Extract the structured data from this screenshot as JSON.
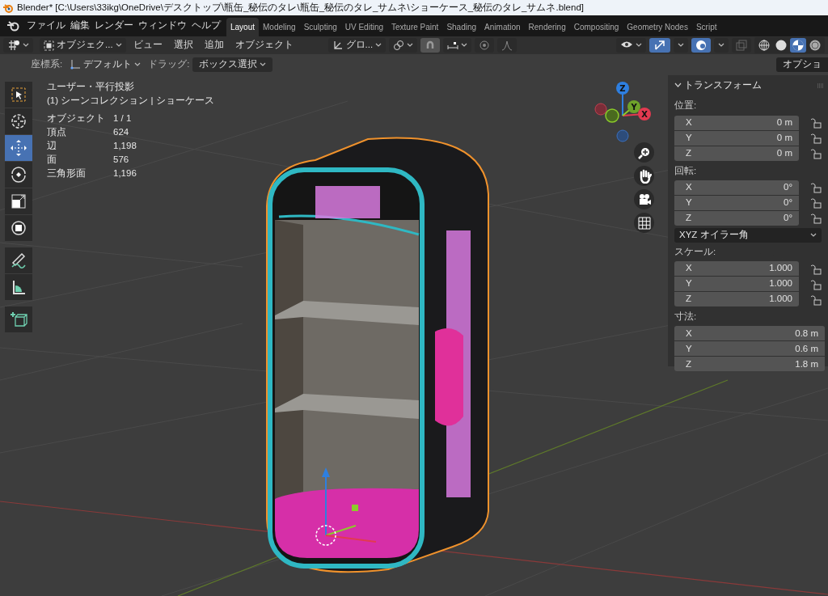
{
  "window": {
    "title": "Blender* [C:\\Users\\33ikg\\OneDrive\\デスクトップ\\瓶缶_秘伝のタレ\\瓶缶_秘伝のタレ_サムネ\\ショーケース_秘伝のタレ_サムネ.blend]"
  },
  "menu": [
    "ファイル",
    "編集",
    "レンダー",
    "ウィンドウ",
    "ヘルプ"
  ],
  "workspaces": [
    {
      "label": "Layout",
      "selected": true
    },
    {
      "label": "Modeling",
      "selected": false
    },
    {
      "label": "Sculpting",
      "selected": false
    },
    {
      "label": "UV Editing",
      "selected": false
    },
    {
      "label": "Texture Paint",
      "selected": false
    },
    {
      "label": "Shading",
      "selected": false
    },
    {
      "label": "Animation",
      "selected": false
    },
    {
      "label": "Rendering",
      "selected": false
    },
    {
      "label": "Compositing",
      "selected": false
    },
    {
      "label": "Geometry Nodes",
      "selected": false
    },
    {
      "label": "Script",
      "selected": false
    }
  ],
  "header": {
    "mode": "オブジェク...",
    "menus": [
      "ビュー",
      "選択",
      "追加",
      "オブジェクト"
    ],
    "orientation": "グロ...",
    "gizmos_on": true,
    "overlays_on": true,
    "shading_modes": [
      {
        "kind": "wireframe",
        "selected": false
      },
      {
        "kind": "solid",
        "selected": false
      },
      {
        "kind": "material",
        "selected": true
      },
      {
        "kind": "rendered",
        "selected": false
      }
    ]
  },
  "tool_settings": {
    "orientation_label": "座標系:",
    "orientation": "デフォルト",
    "drag_label": "ドラッグ:",
    "drag": "ボックス選択",
    "options": "オプショ"
  },
  "toolbar": [
    {
      "kind": "select",
      "selected": false
    },
    {
      "kind": "cursor",
      "selected": false
    },
    {
      "kind": "move",
      "selected": true
    },
    {
      "kind": "rotate",
      "selected": false
    },
    {
      "kind": "scale",
      "selected": false
    },
    {
      "kind": "transform",
      "selected": false
    },
    {
      "kind": "annotate",
      "selected": false
    },
    {
      "kind": "measure",
      "selected": false
    },
    {
      "kind": "add-cube",
      "selected": false
    }
  ],
  "viewport_info": {
    "view": "ユーザー・平行投影",
    "collection": "(1) シーンコレクション | ショーケース",
    "stats": [
      {
        "label": "オブジェクト",
        "value": "1 / 1"
      },
      {
        "label": "頂点",
        "value": "624"
      },
      {
        "label": "辺",
        "value": "1,198"
      },
      {
        "label": "面",
        "value": "576"
      },
      {
        "label": "三角形面",
        "value": "1,196"
      }
    ]
  },
  "gizmo": {
    "labels": [
      "Z",
      "Y",
      "X"
    ]
  },
  "transform_panel": {
    "title": "トランスフォーム",
    "expanded": true,
    "sections": [
      {
        "label": "位置:",
        "fields": [
          {
            "axis": "X",
            "value": "0 m",
            "locked": false
          },
          {
            "axis": "Y",
            "value": "0 m",
            "locked": false
          },
          {
            "axis": "Z",
            "value": "0 m",
            "locked": false
          }
        ]
      },
      {
        "label": "回転:",
        "fields": [
          {
            "axis": "X",
            "value": "0°",
            "locked": false
          },
          {
            "axis": "Y",
            "value": "0°",
            "locked": false
          },
          {
            "axis": "Z",
            "value": "0°",
            "locked": false
          }
        ],
        "mode": "XYZ オイラー角"
      },
      {
        "label": "スケール:",
        "fields": [
          {
            "axis": "X",
            "value": "1.000",
            "locked": false
          },
          {
            "axis": "Y",
            "value": "1.000",
            "locked": false
          },
          {
            "axis": "Z",
            "value": "1.000",
            "locked": false
          }
        ]
      },
      {
        "label": "寸法:",
        "fields": [
          {
            "axis": "X",
            "value": "0.8 m"
          },
          {
            "axis": "Y",
            "value": "0.6 m"
          },
          {
            "axis": "Z",
            "value": "1.8 m"
          }
        ]
      }
    ]
  }
}
